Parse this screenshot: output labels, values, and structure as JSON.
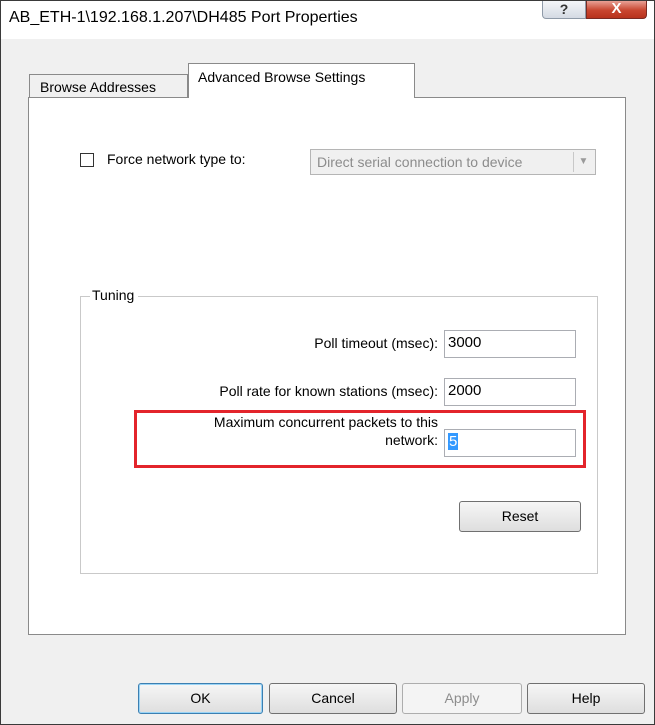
{
  "window": {
    "title": "AB_ETH-1\\192.168.1.207\\DH485 Port Properties",
    "help_glyph": "?",
    "close_glyph": "X"
  },
  "tabs": [
    {
      "label": "Browse Addresses",
      "selected": false
    },
    {
      "label": "Advanced Browse Settings",
      "selected": true
    }
  ],
  "force_network": {
    "label": "Force network type to:",
    "checked": false,
    "selected_option": "Direct serial connection to device",
    "dropdown_glyph": "▼",
    "enabled": false
  },
  "tuning": {
    "title": "Tuning",
    "poll_timeout": {
      "label": "Poll timeout (msec):",
      "value": "3000"
    },
    "poll_rate": {
      "label": "Poll rate for known stations (msec):",
      "value": "2000"
    },
    "max_packets": {
      "label_line1": "Maximum concurrent packets to this",
      "label_line2": "network:",
      "value": "5"
    },
    "reset_label": "Reset"
  },
  "buttons": {
    "ok": "OK",
    "cancel": "Cancel",
    "apply": "Apply",
    "help": "Help"
  },
  "colors": {
    "highlight": "#e3242b",
    "selection": "#3399ff",
    "close_button": "#c8452f"
  }
}
